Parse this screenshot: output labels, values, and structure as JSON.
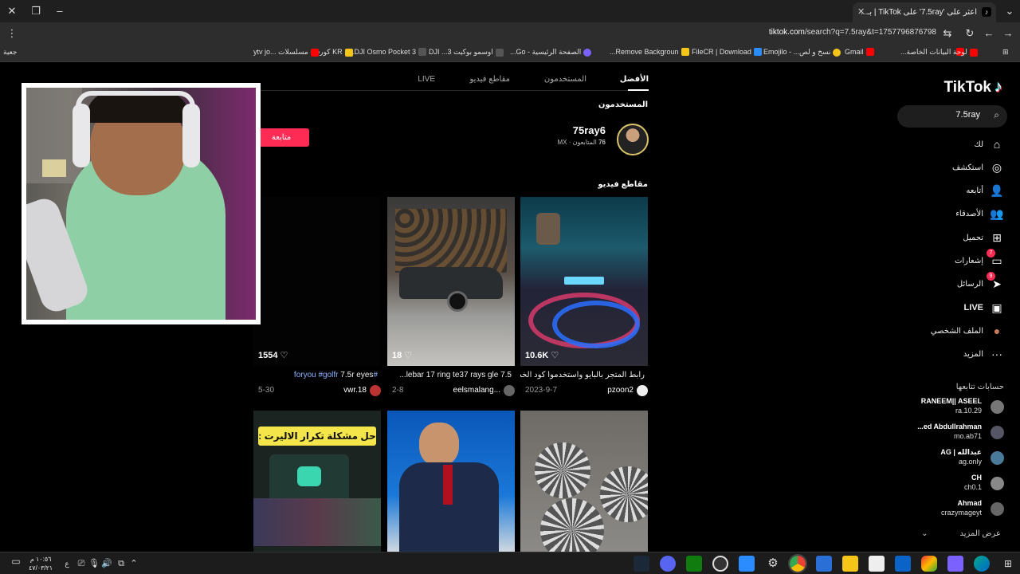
{
  "browser": {
    "tab_title": "اعثر على '7.5ray' على TikTok | بـ...",
    "url_host": "tiktok.com",
    "url_path": "/search?q=7.5ray&t=1757796876798",
    "bookmarks": [
      {
        "label": "لوحة البيانات الخاصة...",
        "color": "#ff0000"
      },
      {
        "label": "Gmail",
        "color": "#ea4335"
      },
      {
        "label": "نسخ و لص... - Emojilo",
        "color": "#f5c518"
      },
      {
        "label": "FileCR | Download",
        "color": "#2a8cff"
      },
      {
        "label": "Remove Backgroun...",
        "color": "#f5c518"
      },
      {
        "label": "الصفحة الرئيسية - Go...",
        "color": "#7b61ff"
      },
      {
        "label": "اوسمو بوكيت 3... DJI",
        "color": "#2b2b2b"
      },
      {
        "label": "DJI Osmo Pocket 3...",
        "color": "#2b2b2b"
      },
      {
        "label": "KR كورفر",
        "color": "#f5c518"
      },
      {
        "label": "مسلسلات ...ytv jo",
        "color": "#ff0000"
      },
      {
        "label": "جعية",
        "color": "#555"
      }
    ]
  },
  "sidebar": {
    "logo": "TikTok",
    "search_value": "7.5ray",
    "nav": [
      {
        "label": "لك",
        "icon": "home-icon",
        "glyph": "⌂"
      },
      {
        "label": "استكشف",
        "icon": "compass-icon",
        "glyph": "◎"
      },
      {
        "label": "أتابعه",
        "icon": "user-plus-icon",
        "glyph": "👤"
      },
      {
        "label": "الأصدقاء",
        "icon": "friends-icon",
        "glyph": "👥"
      },
      {
        "label": "تحميل",
        "icon": "upload-icon",
        "glyph": "⊞"
      },
      {
        "label": "إشعارات",
        "icon": "notifications-icon",
        "glyph": "▭",
        "badge": "7"
      },
      {
        "label": "الرسائل",
        "icon": "messages-icon",
        "glyph": "➤",
        "badge": "9"
      },
      {
        "label": "LIVE",
        "icon": "live-icon",
        "glyph": "▣"
      },
      {
        "label": "الملف الشخصي",
        "icon": "profile-avatar-icon",
        "glyph": "●"
      },
      {
        "label": "المزيد",
        "icon": "more-icon",
        "glyph": "···"
      }
    ],
    "following_title": "حسابات تتابعها",
    "following": [
      {
        "name": "RANEEM|| ASEEL",
        "handle": "ra.10.29"
      },
      {
        "name": "ed Abdullrahman...",
        "handle": "mo.ab71"
      },
      {
        "name": "عبدالله | AG",
        "handle": "ag.only"
      },
      {
        "name": "CH",
        "handle": "ch0.1"
      },
      {
        "name": "Ahmad",
        "handle": "crazymageyt"
      }
    ],
    "see_more": "عرض المزيد"
  },
  "content": {
    "tabs": [
      "الأفضل",
      "المستخدمون",
      "مقاطع فيديو",
      "LIVE"
    ],
    "users_title": "المستخدمون",
    "user": {
      "name": "75ray6",
      "followers": "76",
      "followers_label": "المتابعون",
      "region": "MX",
      "follow_label": "متابعة"
    },
    "videos_title": "مقاطع فيديو",
    "videos": [
      {
        "likes": "10.6K",
        "title": "رابط المتجر بالبايو واستخدموا كود الخصم...",
        "author": "pzoon2",
        "date": "2023-9-7"
      },
      {
        "likes": "18",
        "title": "7.5 lebar 17 ring te37 rays gle...",
        "author": "eelsmalang...",
        "date": "2-8"
      },
      {
        "likes": "1554",
        "title_tag": "#foryou #golfr",
        "title_rest": " 7.5r eyes",
        "author": "vwr.18",
        "date": "5-30"
      }
    ],
    "row2_caption": "حل مشكلة تكرار الاليرت :"
  },
  "taskbar": {
    "time": "١٠:٥٦ م",
    "date": "٤٧/٠٣/٢١",
    "lang": "ع"
  }
}
